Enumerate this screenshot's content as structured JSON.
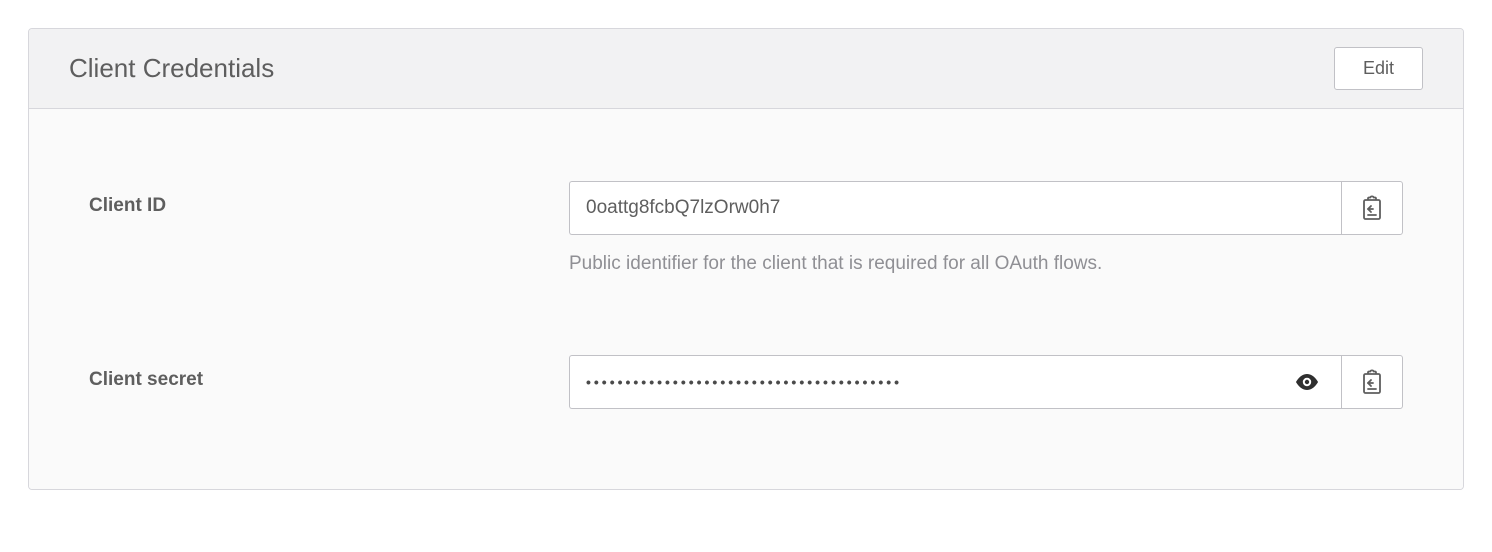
{
  "panel": {
    "title": "Client Credentials",
    "edit_label": "Edit"
  },
  "fields": {
    "client_id": {
      "label": "Client ID",
      "value": "0oattg8fcbQ7lzOrw0h7",
      "help": "Public identifier for the client that is required for all OAuth flows."
    },
    "client_secret": {
      "label": "Client secret",
      "masked_value": "••••••••••••••••••••••••••••••••••••••••"
    }
  },
  "icons": {
    "eye": "eye-icon",
    "clipboard": "clipboard-icon"
  }
}
